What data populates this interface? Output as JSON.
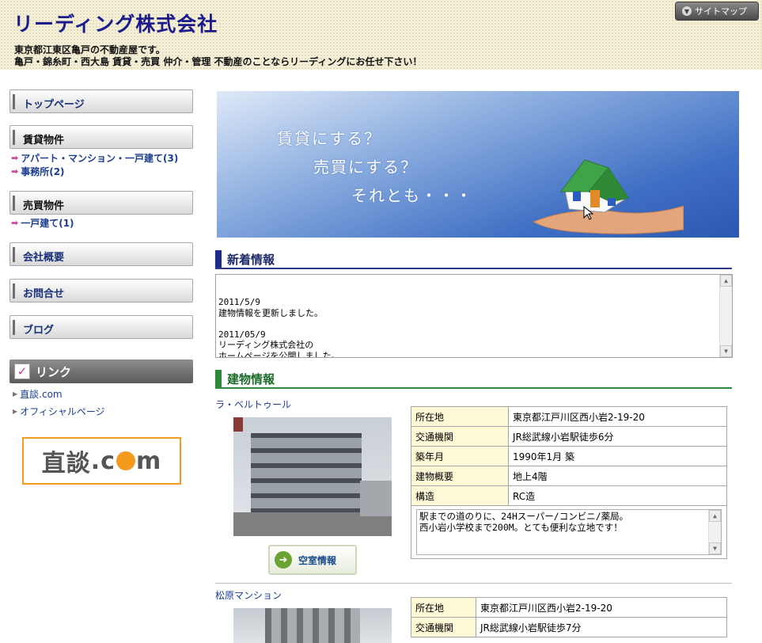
{
  "header": {
    "site_title": "リーディング株式会社",
    "tagline_1": "東京都江東区亀戸の不動産屋です。",
    "tagline_2": "亀戸・錦糸町・西大島 賃貸・売買 仲介・管理 不動産のことならリーディングにお任せ下さい！",
    "sitemap_label": "サイトマップ"
  },
  "sidebar": {
    "top_page": "トップページ",
    "rental": "賃貸物件",
    "rental_links": [
      "アパート・マンション・一戸建て(3)",
      "事務所(2)"
    ],
    "sale": "売買物件",
    "sale_links": [
      "一戸建て(1)"
    ],
    "company": "会社概要",
    "contact": "お問合せ",
    "blog": "ブログ",
    "links_heading": "リンク",
    "links": [
      "直談.com",
      "オフィシャルページ"
    ],
    "banner_text_left": "直談",
    "banner_text_right": "m"
  },
  "banner": {
    "line1": "賃貸にする？",
    "line2": "売買にする？",
    "line3": "それとも・・・"
  },
  "news": {
    "heading": "新着情報",
    "text": "2011/5/9\n建物情報を更新しました。\n\n2011/05/9\nリーディング株式会社の\nホームページを公開しました。"
  },
  "buildings": {
    "heading": "建物情報",
    "vacancy_label": "空室情報",
    "items": [
      {
        "name": "ラ・ベルトゥール",
        "rows": [
          [
            "所在地",
            "東京都江戸川区西小岩2-19-20"
          ],
          [
            "交通機関",
            "JR総武線小岩駅徒歩6分"
          ],
          [
            "築年月",
            "1990年1月 築"
          ],
          [
            "建物概要",
            "地上4階"
          ],
          [
            "構造",
            "RC造"
          ]
        ],
        "description": "駅までの道のりに、24Hスーパー/コンビニ/薬局。\n西小岩小学校まで200M。とても便利な立地です！"
      },
      {
        "name": "松原マンション",
        "rows": [
          [
            "所在地",
            "東京都江戸川区西小岩2-19-20"
          ],
          [
            "交通機関",
            "JR総武線小岩駅徒歩7分"
          ]
        ]
      }
    ]
  }
}
